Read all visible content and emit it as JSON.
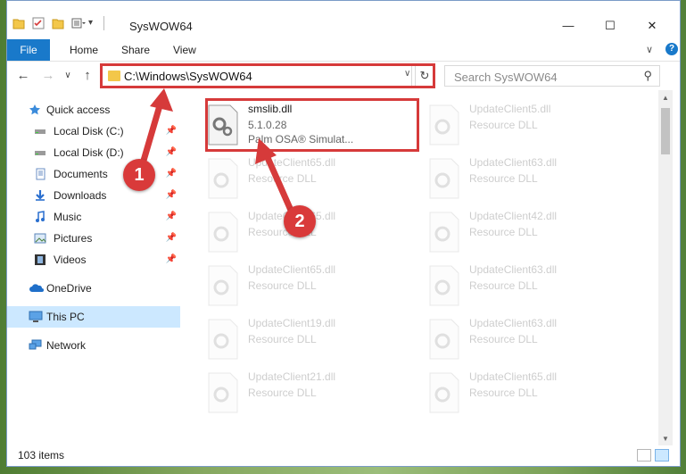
{
  "window": {
    "title": "SysWOW64",
    "controls": {
      "minimize": "—",
      "maximize": "☐",
      "close": "✕"
    }
  },
  "ribbon": {
    "tabs": [
      "File",
      "Home",
      "Share",
      "View"
    ],
    "expand_glyph": "∨",
    "help_glyph": "?"
  },
  "navigation": {
    "back": "←",
    "forward": "→",
    "recent": "∨",
    "up": "↑",
    "address_path": "C:\\Windows\\SysWOW64",
    "address_dropdown": "∨",
    "refresh": "↻",
    "search_placeholder": "Search SysWOW64",
    "search_glyph": "⚲"
  },
  "sidebar": {
    "quick_access": "Quick access",
    "items": [
      {
        "label": "Local Disk (C:)",
        "icon": "drive-icon",
        "pinned": true
      },
      {
        "label": "Local Disk (D:)",
        "icon": "drive-icon",
        "pinned": true
      },
      {
        "label": "Documents",
        "icon": "documents-icon",
        "pinned": true
      },
      {
        "label": "Downloads",
        "icon": "downloads-icon",
        "pinned": true
      },
      {
        "label": "Music",
        "icon": "music-icon",
        "pinned": true
      },
      {
        "label": "Pictures",
        "icon": "pictures-icon",
        "pinned": true
      },
      {
        "label": "Videos",
        "icon": "videos-icon",
        "pinned": true
      }
    ],
    "pin_glyph": "📌",
    "onedrive": "OneDrive",
    "this_pc": "This PC",
    "network": "Network"
  },
  "files": [
    {
      "name": "smslib.dll",
      "line2": "5.1.0.28",
      "line3": "Palm OSA® Simulat...",
      "highlighted": true
    },
    {
      "name": "UpdateClient5.dll",
      "line2": "Resource DLL"
    },
    {
      "name": "UpdateClient65.dll",
      "line2": "Resource DLL"
    },
    {
      "name": "UpdateClient63.dll",
      "line2": "Resource DLL"
    },
    {
      "name": "UpdateClient65.dll",
      "line2": "Resource DLL"
    },
    {
      "name": "UpdateClient42.dll",
      "line2": "Resource DLL"
    },
    {
      "name": "UpdateClient65.dll",
      "line2": "Resource DLL"
    },
    {
      "name": "UpdateClient63.dll",
      "line2": "Resource DLL"
    },
    {
      "name": "UpdateClient19.dll",
      "line2": "Resource DLL"
    },
    {
      "name": "UpdateClient63.dll",
      "line2": "Resource DLL"
    },
    {
      "name": "UpdateClient21.dll",
      "line2": "Resource DLL"
    },
    {
      "name": "UpdateClient65.dll",
      "line2": "Resource DLL"
    }
  ],
  "status": {
    "item_count": "103 items"
  },
  "callouts": [
    "1",
    "2"
  ],
  "colors": {
    "accent": "#1979ca",
    "highlight": "#d63a3a",
    "selected_bg": "#cce8ff"
  }
}
